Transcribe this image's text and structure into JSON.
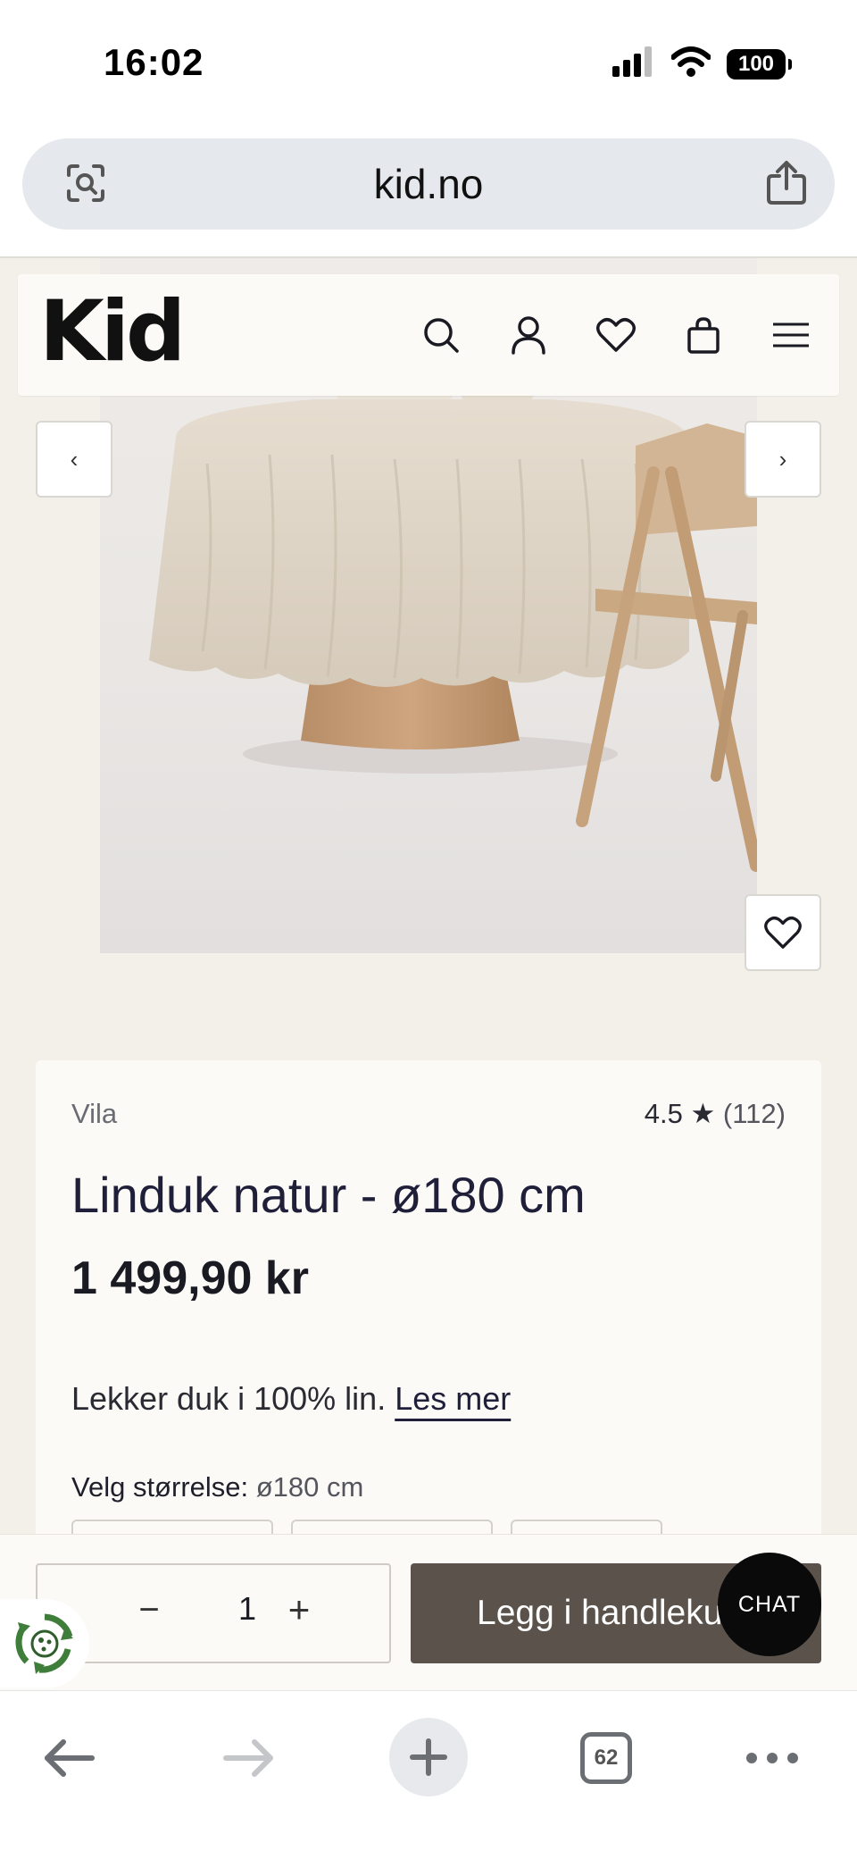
{
  "status_bar": {
    "time": "16:02",
    "battery": "100",
    "signal_icon": "cellular-signal-icon",
    "wifi_icon": "wifi-icon"
  },
  "browser": {
    "url": "kid.no",
    "left_icon": "visual-lookup-icon",
    "right_icon": "share-icon"
  },
  "site_header": {
    "logo": "Kid",
    "icons": [
      "search-icon",
      "account-icon",
      "wishlist-heart-icon",
      "shopping-bag-icon",
      "menu-icon"
    ]
  },
  "gallery": {
    "prev_label": "‹",
    "next_label": "›"
  },
  "product": {
    "brand": "Vila",
    "rating_value": "4.5 ★",
    "rating_count": "(112)",
    "title": "Linduk natur - ø180 cm",
    "price": "1 499,90 kr",
    "description": "Lekker duk i 100% lin.",
    "read_more": "Les mer",
    "size_label": "Velg størrelse:",
    "size_selected": "ø180 cm"
  },
  "purchase_bar": {
    "qty_minus": "−",
    "quantity": "1",
    "qty_plus": "+",
    "add_to_cart": "Legg i handlekurv",
    "chat": "CHAT"
  },
  "toolbar": {
    "tabs_count": "62"
  },
  "colors": {
    "page_bg": "#f3f0e9",
    "card_bg": "#fbfaf6",
    "cart_button": "#5a524b",
    "chat_button": "#0a0a0a",
    "eco_green": "#3f7d3a"
  }
}
